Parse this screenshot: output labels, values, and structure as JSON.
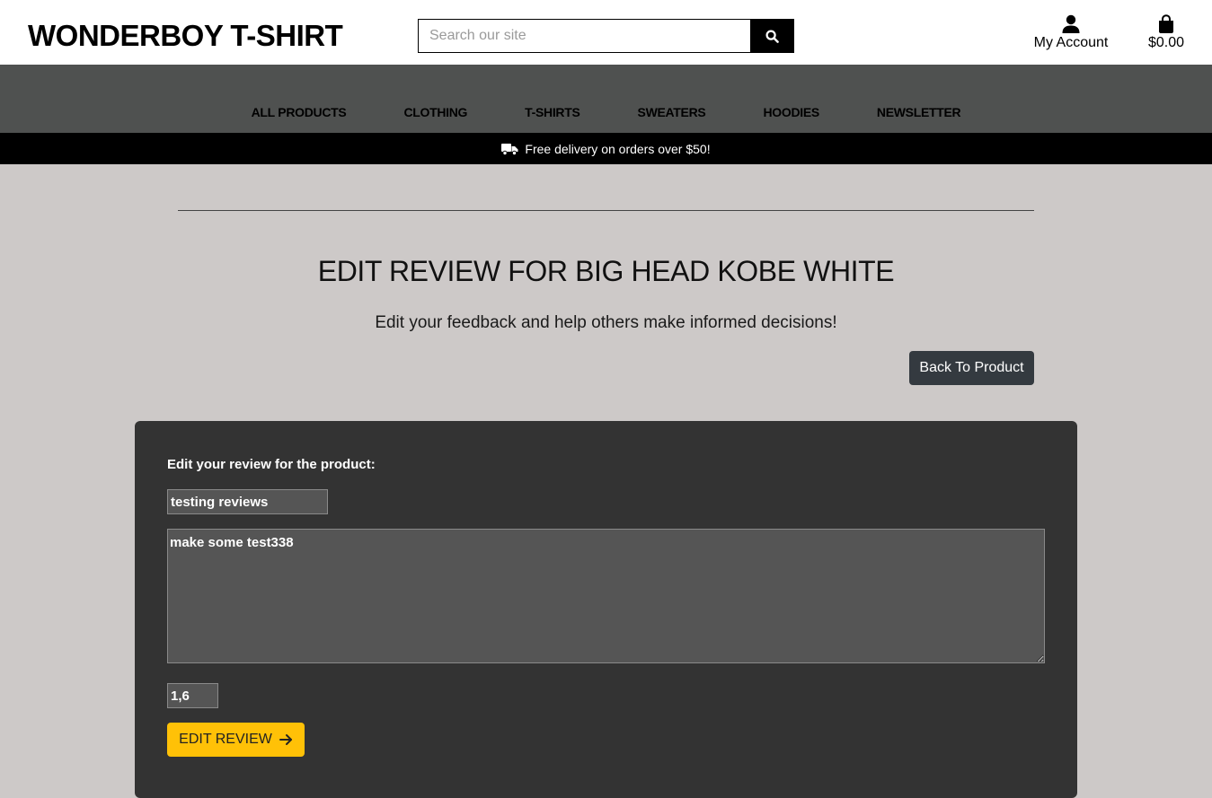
{
  "header": {
    "brand": "WONDERBOY T-SHIRT",
    "search_placeholder": "Search our site",
    "search_icon": "search-icon",
    "account_label": "My Account",
    "account_icon": "user-icon",
    "bag_total": "$0.00",
    "bag_icon": "shopping-bag-icon"
  },
  "nav": {
    "items": [
      {
        "label": "ALL PRODUCTS"
      },
      {
        "label": "CLOTHING"
      },
      {
        "label": "T-SHIRTS"
      },
      {
        "label": "SWEATERS"
      },
      {
        "label": "HOODIES"
      },
      {
        "label": "NEWSLETTER"
      }
    ]
  },
  "banner": {
    "icon": "truck-icon",
    "text": "Free delivery on orders over $50!"
  },
  "main": {
    "title": "EDIT REVIEW FOR BIG HEAD KOBE WHITE",
    "subtitle": "Edit your feedback and help others make informed decisions!",
    "back_button": "Back To Product"
  },
  "form": {
    "label": "Edit your review for the product:",
    "title_value": "testing reviews",
    "body_value": "make some test338",
    "rating_value": "1,6",
    "submit_label": "EDIT REVIEW",
    "submit_icon": "arrow-right-icon"
  },
  "colors": {
    "page_bg": "#cdc9c8",
    "nav_bg": "#4f5150",
    "banner_bg": "#000000",
    "card_bg": "#333333",
    "input_bg": "#555555",
    "back_button_bg": "#343a40",
    "submit_bg": "#ffc107"
  }
}
